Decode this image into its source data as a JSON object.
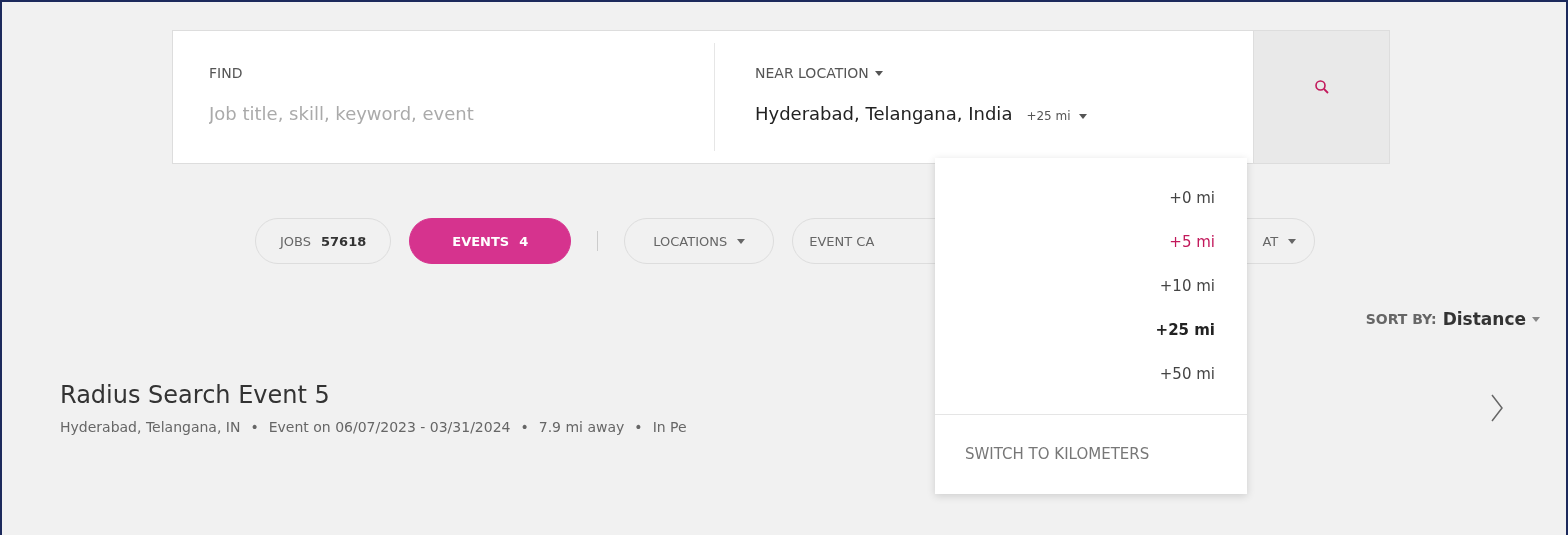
{
  "search": {
    "find_label": "FIND",
    "find_placeholder": "Job title, skill, keyword, event",
    "location_label": "NEAR LOCATION",
    "location_value": "Hyderabad, Telangana, India",
    "radius": "+25 mi"
  },
  "chips": [
    {
      "kind": "count",
      "label": "JOBS",
      "count": "57618",
      "selected": false
    },
    {
      "kind": "count",
      "label": "EVENTS",
      "count": "4",
      "selected": true
    },
    {
      "kind": "divider"
    },
    {
      "kind": "menu",
      "label": "LOCATIONS",
      "caret": true
    },
    {
      "kind": "menu",
      "label": "EVENT CA",
      "caret": false
    },
    {
      "kind": "menu",
      "label": "AT",
      "caret": true
    }
  ],
  "sort": {
    "label": "SORT BY:",
    "value": "Distance"
  },
  "results": [
    {
      "title": "Radius Search Event 5",
      "separator": "•",
      "meta": [
        "Hyderabad, Telangana, IN",
        "Event on 06/07/2023 - 03/31/2024",
        "7.9 mi away",
        "In Pe"
      ]
    }
  ],
  "radius_menu": {
    "options": [
      {
        "label": "+0 mi",
        "selected": false,
        "hovered": false
      },
      {
        "label": "+5 mi",
        "selected": false,
        "hovered": true
      },
      {
        "label": "+10 mi",
        "selected": false,
        "hovered": false
      },
      {
        "label": "+25 mi",
        "selected": true,
        "hovered": false
      },
      {
        "label": "+50 mi",
        "selected": false,
        "hovered": false
      }
    ],
    "footer": "SWITCH TO KILOMETERS"
  }
}
